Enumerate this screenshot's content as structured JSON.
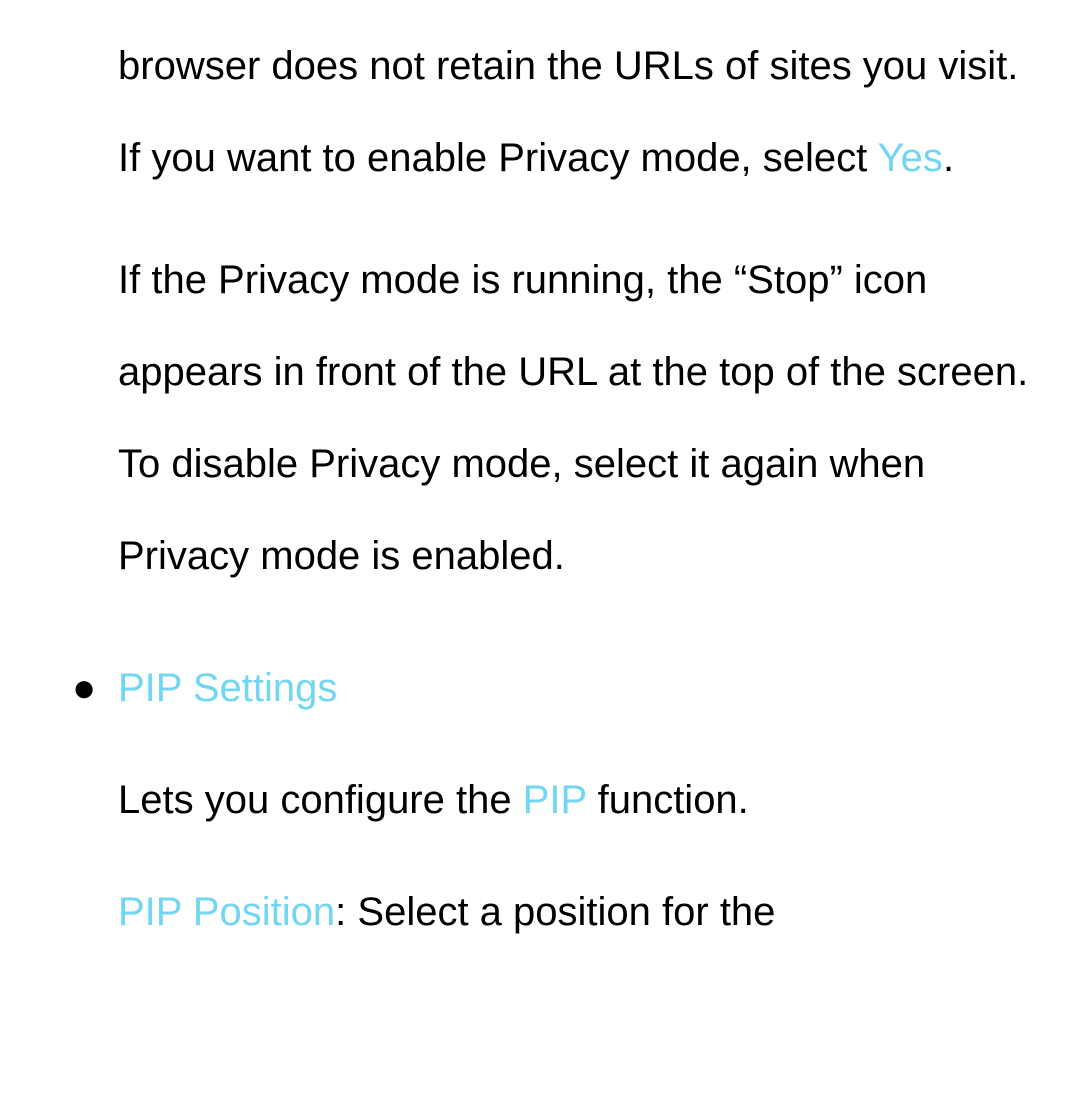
{
  "para1_text1": "browser does not retain the URLs of sites you visit. If you want to enable Privacy mode, select ",
  "para1_highlight": "Yes",
  "para1_text2": ".",
  "para2_text": "If the Privacy mode is running, the “Stop” icon appears in front of the URL at the top of the screen. To disable Privacy mode, select it again when Privacy mode is enabled.",
  "bullet_marker": "●",
  "section_title": "PIP Settings",
  "pip_para1_text1": "Lets you configure the ",
  "pip_para1_highlight": "PIP",
  "pip_para1_text2": " function.",
  "pip_para2_highlight": "PIP Position",
  "pip_para2_text1": ": Select a position for the"
}
